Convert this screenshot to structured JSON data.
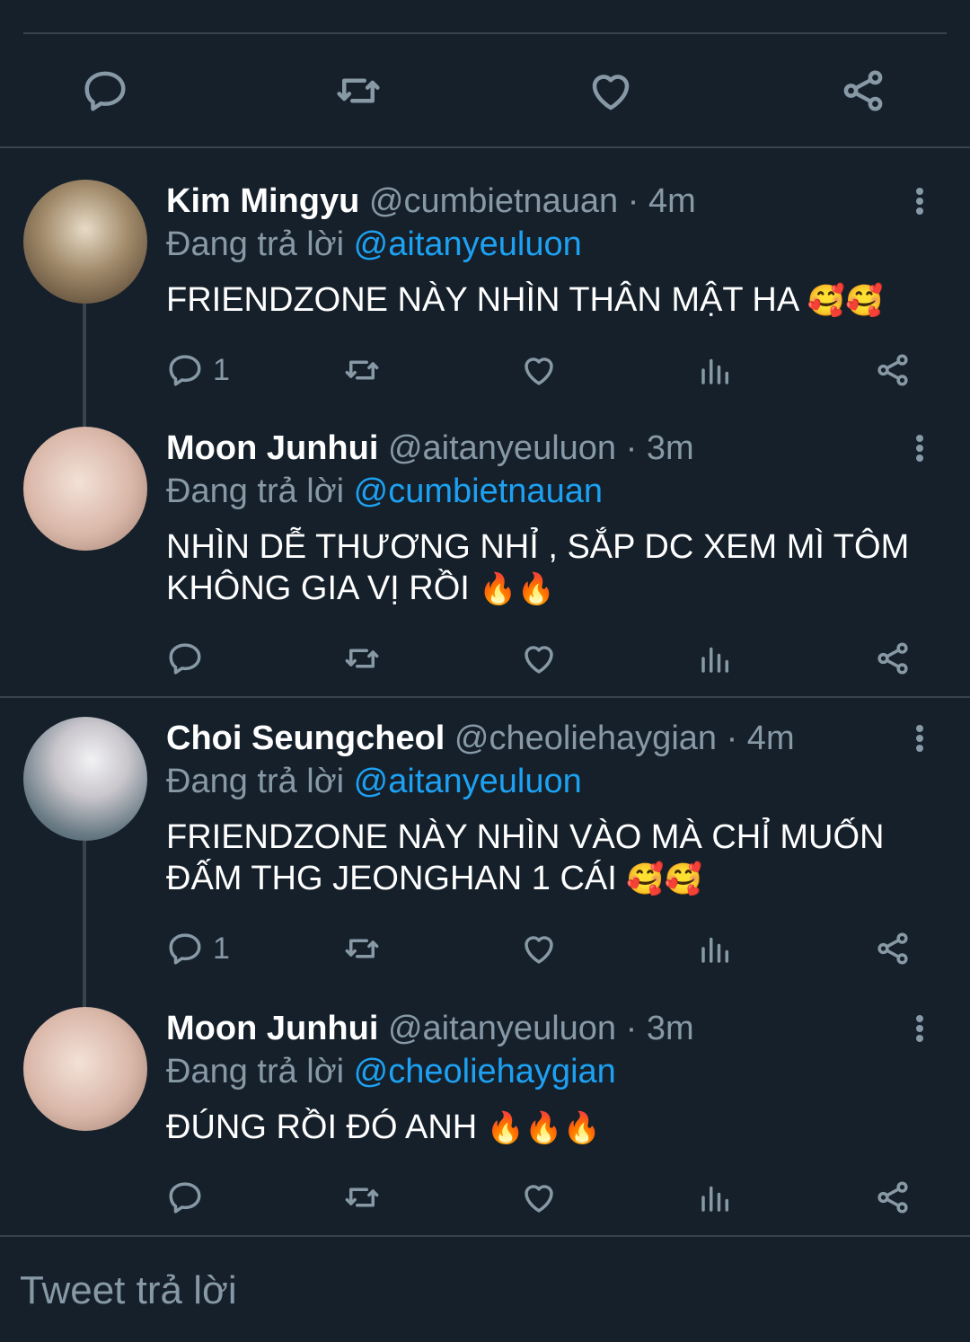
{
  "main_actions": [
    "reply-icon",
    "retweet-icon",
    "like-icon",
    "share-icon"
  ],
  "replies": [
    {
      "name": "Kim Mingyu",
      "handle": "@cumbietnauan",
      "time": "· 4m",
      "replying_prefix": "Đang trả lời",
      "replying_to": "@aitanyeuluon",
      "text": "FRIENDZONE NÀY NHÌN THÂN MẬT HA",
      "emoji": "🥰🥰",
      "reply_count": "1"
    },
    {
      "name": "Moon Junhui",
      "handle": "@aitanyeuluon",
      "time": "· 3m",
      "replying_prefix": "Đang trả lời",
      "replying_to": "@cumbietnauan",
      "text": "NHÌN DỄ THƯƠNG NHỈ , SẮP DC XEM MÌ TÔM KHÔNG GIA VỊ RỒI",
      "emoji": "🔥🔥",
      "reply_count": ""
    },
    {
      "name": "Choi Seungcheol",
      "handle": "@cheoliehaygian",
      "time": "· 4m",
      "replying_prefix": "Đang trả lời",
      "replying_to": "@aitanyeuluon",
      "text": "FRIENDZONE NÀY NHÌN VÀO MÀ CHỈ MUỐN ĐẤM THG JEONGHAN 1 CÁI",
      "emoji": "🥰🥰",
      "reply_count": "1"
    },
    {
      "name": "Moon Junhui",
      "handle": "@aitanyeuluon",
      "time": "· 3m",
      "replying_prefix": "Đang trả lời",
      "replying_to": "@cheoliehaygian",
      "text": "ĐÚNG RỒI ĐÓ ANH",
      "emoji": "🔥🔥🔥",
      "reply_count": ""
    }
  ],
  "composer": {
    "placeholder": "Tweet trả lời"
  },
  "colors": {
    "background": "#15202b",
    "divider": "#38444d",
    "muted": "#8899a6",
    "link": "#1da1f2"
  }
}
